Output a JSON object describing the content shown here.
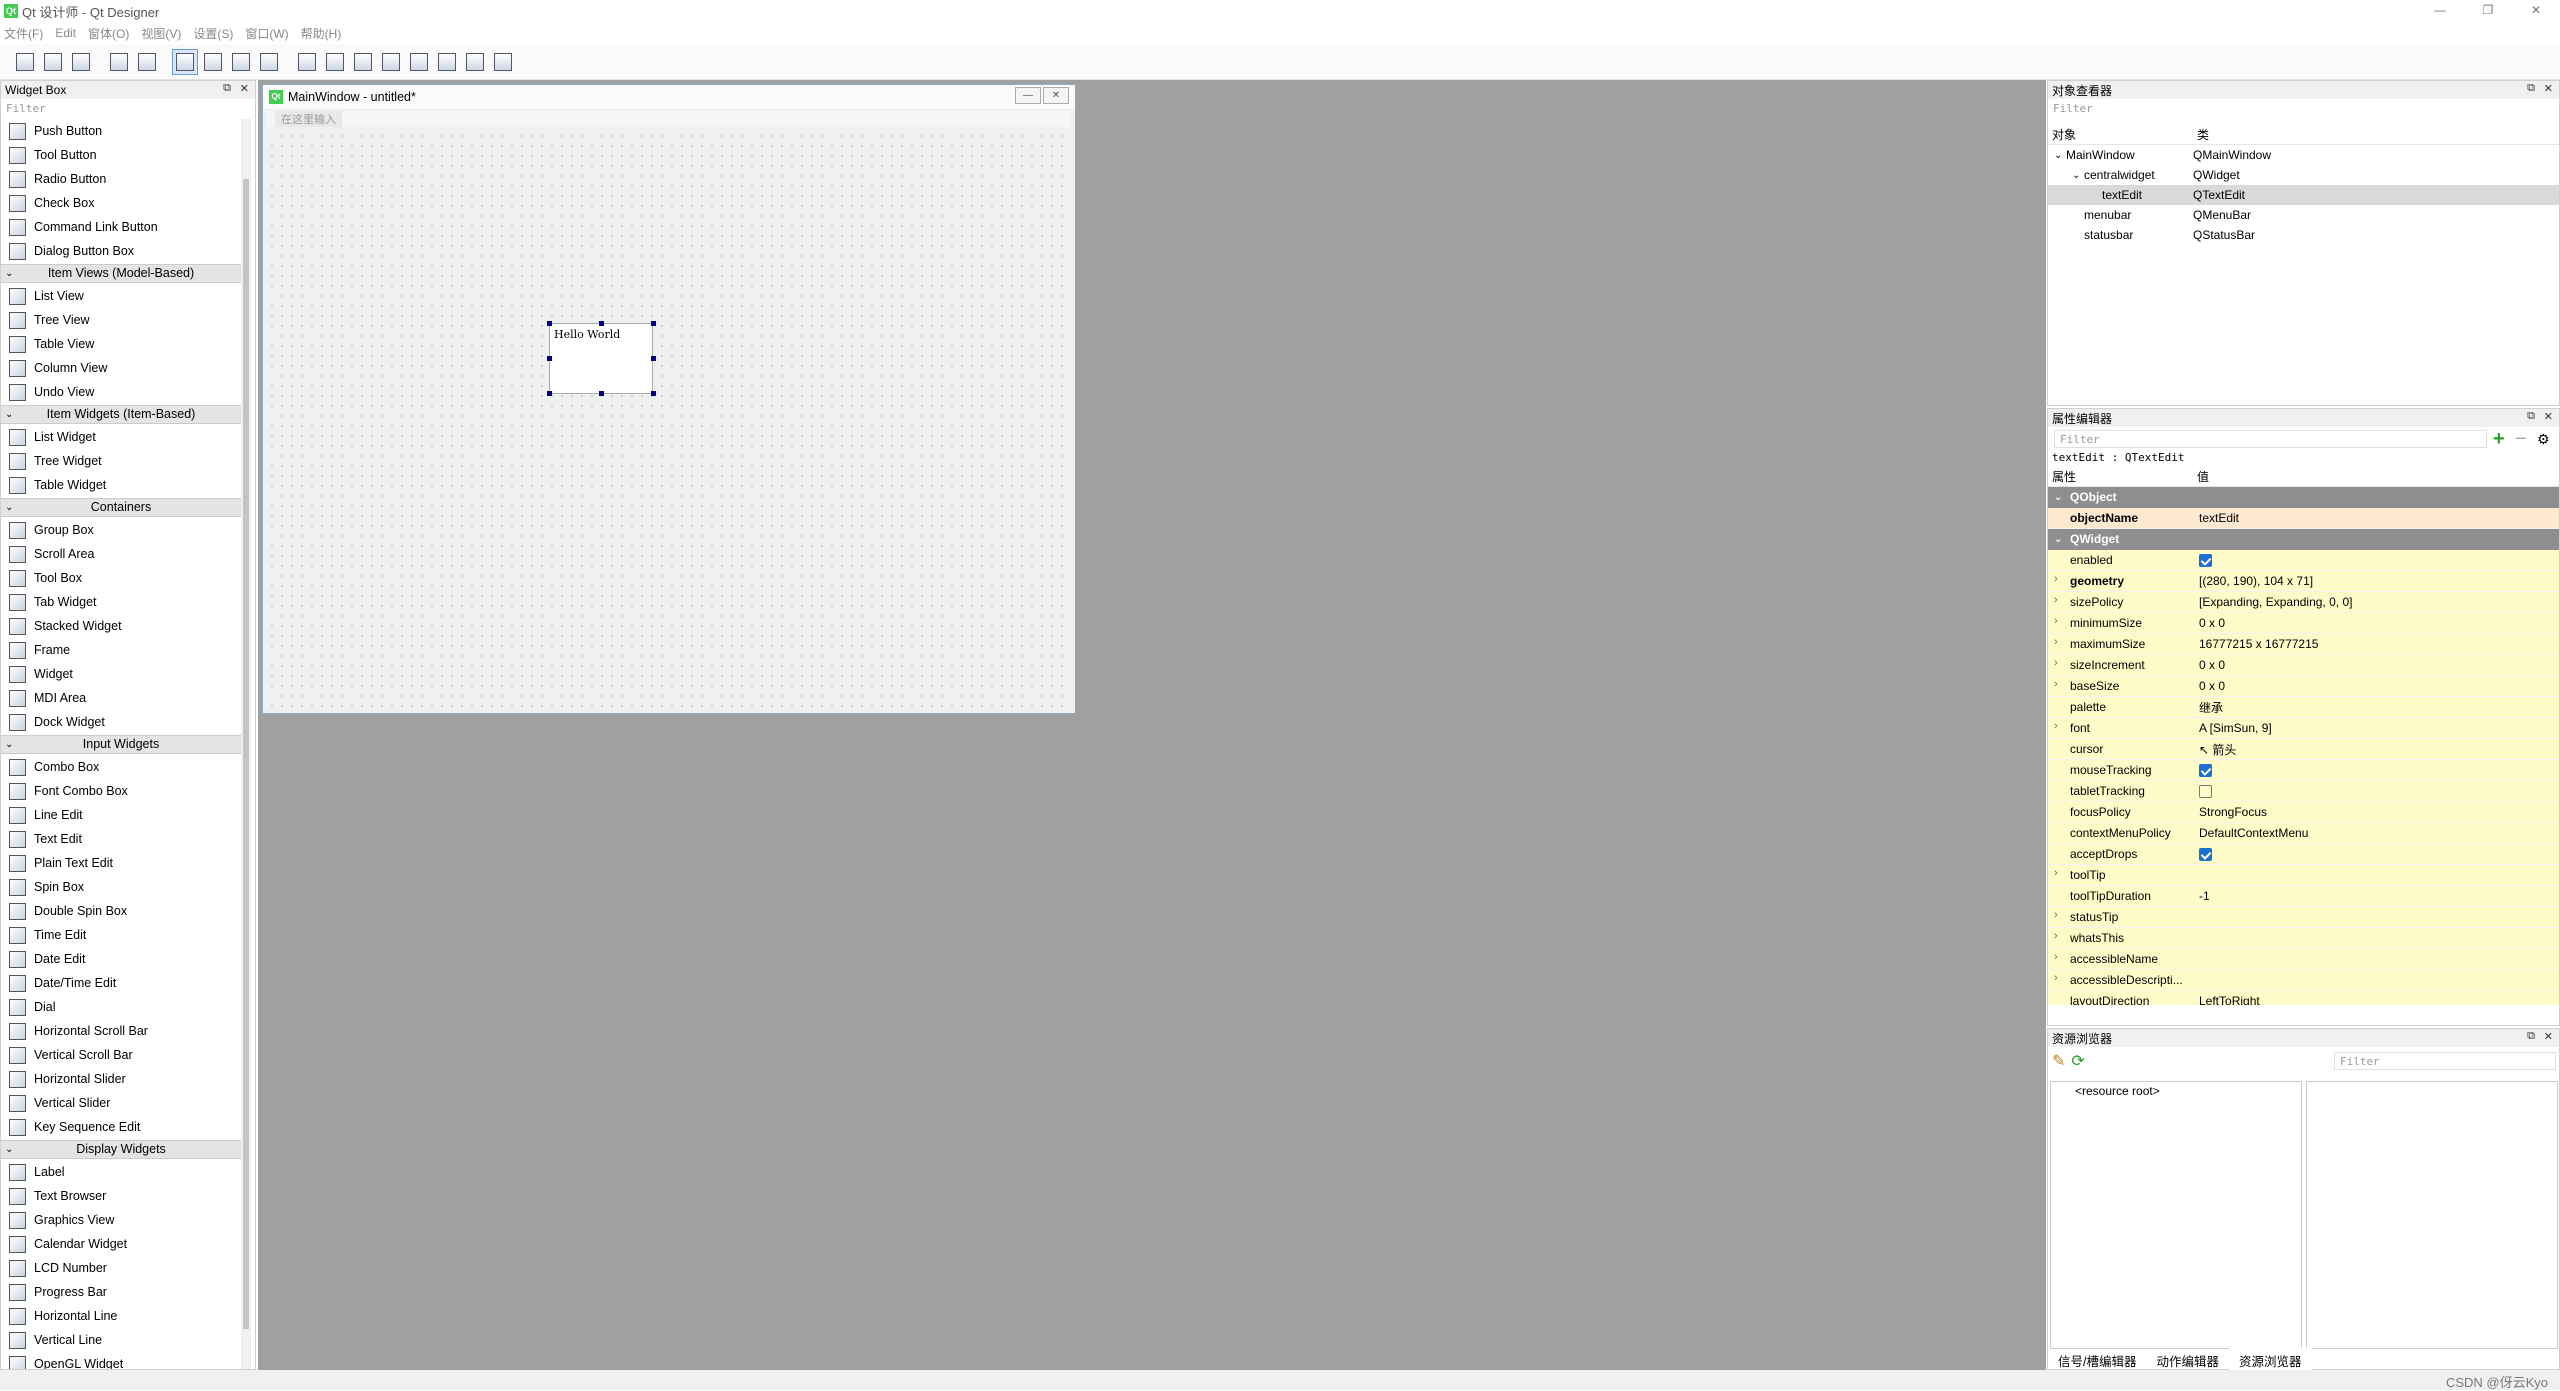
{
  "app": {
    "title": "Qt 设计师 - Qt Designer",
    "icon": "qt-designer-icon"
  },
  "window_controls": [
    "—",
    "❐",
    "✕"
  ],
  "menu": [
    "文件(F)",
    "Edit",
    "窗体(O)",
    "视图(V)",
    "设置(S)",
    "窗口(W)",
    "帮助(H)"
  ],
  "toolbar": [
    "new-icon",
    "open-icon",
    "save-icon",
    "sep",
    "send-to-back-icon",
    "bring-to-front-icon",
    "sep",
    "edit-widgets-icon",
    "edit-signals-icon",
    "edit-buddies-icon",
    "edit-tab-order-icon",
    "sep",
    "layout-horizontal-icon",
    "layout-vertical-icon",
    "layout-h-splitter-icon",
    "layout-v-splitter-icon",
    "layout-grid-icon",
    "layout-form-icon",
    "break-layout-icon",
    "adjust-size-icon"
  ],
  "widget_box": {
    "title": "Widget Box",
    "filter": "Filter",
    "sections": [
      {
        "type": "item",
        "label": "Push Button"
      },
      {
        "type": "item",
        "label": "Tool Button"
      },
      {
        "type": "item",
        "label": "Radio Button"
      },
      {
        "type": "item",
        "label": "Check Box"
      },
      {
        "type": "item",
        "label": "Command Link Button"
      },
      {
        "type": "item",
        "label": "Dialog Button Box"
      },
      {
        "type": "cat",
        "label": "Item Views (Model-Based)"
      },
      {
        "type": "item",
        "label": "List View"
      },
      {
        "type": "item",
        "label": "Tree View"
      },
      {
        "type": "item",
        "label": "Table View"
      },
      {
        "type": "item",
        "label": "Column View"
      },
      {
        "type": "item",
        "label": "Undo View"
      },
      {
        "type": "cat",
        "label": "Item Widgets (Item-Based)"
      },
      {
        "type": "item",
        "label": "List Widget"
      },
      {
        "type": "item",
        "label": "Tree Widget"
      },
      {
        "type": "item",
        "label": "Table Widget"
      },
      {
        "type": "cat",
        "label": "Containers"
      },
      {
        "type": "item",
        "label": "Group Box"
      },
      {
        "type": "item",
        "label": "Scroll Area"
      },
      {
        "type": "item",
        "label": "Tool Box"
      },
      {
        "type": "item",
        "label": "Tab Widget"
      },
      {
        "type": "item",
        "label": "Stacked Widget"
      },
      {
        "type": "item",
        "label": "Frame"
      },
      {
        "type": "item",
        "label": "Widget"
      },
      {
        "type": "item",
        "label": "MDI Area"
      },
      {
        "type": "item",
        "label": "Dock Widget"
      },
      {
        "type": "cat",
        "label": "Input Widgets"
      },
      {
        "type": "item",
        "label": "Combo Box"
      },
      {
        "type": "item",
        "label": "Font Combo Box"
      },
      {
        "type": "item",
        "label": "Line Edit"
      },
      {
        "type": "item",
        "label": "Text Edit"
      },
      {
        "type": "item",
        "label": "Plain Text Edit"
      },
      {
        "type": "item",
        "label": "Spin Box"
      },
      {
        "type": "item",
        "label": "Double Spin Box"
      },
      {
        "type": "item",
        "label": "Time Edit"
      },
      {
        "type": "item",
        "label": "Date Edit"
      },
      {
        "type": "item",
        "label": "Date/Time Edit"
      },
      {
        "type": "item",
        "label": "Dial"
      },
      {
        "type": "item",
        "label": "Horizontal Scroll Bar"
      },
      {
        "type": "item",
        "label": "Vertical Scroll Bar"
      },
      {
        "type": "item",
        "label": "Horizontal Slider"
      },
      {
        "type": "item",
        "label": "Vertical Slider"
      },
      {
        "type": "item",
        "label": "Key Sequence Edit"
      },
      {
        "type": "cat",
        "label": "Display Widgets"
      },
      {
        "type": "item",
        "label": "Label"
      },
      {
        "type": "item",
        "label": "Text Browser"
      },
      {
        "type": "item",
        "label": "Graphics View"
      },
      {
        "type": "item",
        "label": "Calendar Widget"
      },
      {
        "type": "item",
        "label": "LCD Number"
      },
      {
        "type": "item",
        "label": "Progress Bar"
      },
      {
        "type": "item",
        "label": "Horizontal Line"
      },
      {
        "type": "item",
        "label": "Vertical Line"
      },
      {
        "type": "item",
        "label": "OpenGL Widget"
      }
    ]
  },
  "form_window": {
    "title": "MainWindow - untitled*",
    "menu_placeholder": "在这里输入",
    "text_edit_content": "Hello World"
  },
  "object_inspector": {
    "title": "对象查看器",
    "filter": "Filter",
    "col_object": "对象",
    "col_class": "类",
    "rows": [
      {
        "name": "MainWindow",
        "cls": "QMainWindow",
        "level": 0,
        "expand": "⌄"
      },
      {
        "name": "centralwidget",
        "cls": "QWidget",
        "level": 1,
        "expand": "⌄"
      },
      {
        "name": "textEdit",
        "cls": "QTextEdit",
        "level": 2,
        "expand": ""
      },
      {
        "name": "menubar",
        "cls": "QMenuBar",
        "level": 1,
        "expand": ""
      },
      {
        "name": "statusbar",
        "cls": "QStatusBar",
        "level": 1,
        "expand": ""
      }
    ]
  },
  "property_editor": {
    "title": "属性编辑器",
    "filter": "Filter",
    "object_label": "textEdit : QTextEdit",
    "col_property": "属性",
    "col_value": "值",
    "rows": [
      {
        "t": "grp",
        "n": "QObject"
      },
      {
        "t": "p",
        "n": "objectName",
        "v": "textEdit",
        "bold": true,
        "bg": "#fde8d0"
      },
      {
        "t": "grp",
        "n": "QWidget"
      },
      {
        "t": "p",
        "n": "enabled",
        "cb": true,
        "bg": "#fffbc8"
      },
      {
        "t": "p",
        "n": "geometry",
        "v": "[(280, 190), 104 x 71]",
        "bold": true,
        "exp": "›",
        "bg": "#fffbc8"
      },
      {
        "t": "p",
        "n": "sizePolicy",
        "v": "[Expanding, Expanding, 0, 0]",
        "exp": "›",
        "bg": "#fffbc8"
      },
      {
        "t": "p",
        "n": "minimumSize",
        "v": "0 x 0",
        "exp": "›",
        "bg": "#fffbc8"
      },
      {
        "t": "p",
        "n": "maximumSize",
        "v": "16777215 x 16777215",
        "exp": "›",
        "bg": "#fffbc8"
      },
      {
        "t": "p",
        "n": "sizeIncrement",
        "v": "0 x 0",
        "exp": "›",
        "bg": "#fffbc8"
      },
      {
        "t": "p",
        "n": "baseSize",
        "v": "0 x 0",
        "exp": "›",
        "bg": "#fffbc8"
      },
      {
        "t": "p",
        "n": "palette",
        "v": "继承",
        "bg": "#fffbc8"
      },
      {
        "t": "p",
        "n": "font",
        "v": "A  [SimSun, 9]",
        "exp": "›",
        "bg": "#fffbc8"
      },
      {
        "t": "p",
        "n": "cursor",
        "v": "↖  箭头",
        "bg": "#fffbc8"
      },
      {
        "t": "p",
        "n": "mouseTracking",
        "cb": true,
        "bg": "#fffbc8"
      },
      {
        "t": "p",
        "n": "tabletTracking",
        "cb": false,
        "bg": "#fffbc8"
      },
      {
        "t": "p",
        "n": "focusPolicy",
        "v": "StrongFocus",
        "bg": "#fffbc8"
      },
      {
        "t": "p",
        "n": "contextMenuPolicy",
        "v": "DefaultContextMenu",
        "bg": "#fffbc8"
      },
      {
        "t": "p",
        "n": "acceptDrops",
        "cb": true,
        "bg": "#fffbc8"
      },
      {
        "t": "p",
        "n": "toolTip",
        "v": "",
        "exp": "›",
        "bg": "#fffbc8"
      },
      {
        "t": "p",
        "n": "toolTipDuration",
        "v": "-1",
        "bg": "#fffbc8"
      },
      {
        "t": "p",
        "n": "statusTip",
        "v": "",
        "exp": "›",
        "bg": "#fffbc8"
      },
      {
        "t": "p",
        "n": "whatsThis",
        "v": "",
        "exp": "›",
        "bg": "#fffbc8"
      },
      {
        "t": "p",
        "n": "accessibleName",
        "v": "",
        "exp": "›",
        "bg": "#fffbc8"
      },
      {
        "t": "p",
        "n": "accessibleDescripti...",
        "v": "",
        "exp": "›",
        "bg": "#fffbc8"
      },
      {
        "t": "p",
        "n": "layoutDirection",
        "v": "LeftToRight",
        "bg": "#fffbc8"
      }
    ]
  },
  "resource_browser": {
    "title": "资源浏览器",
    "filter": "Filter",
    "root": "<resource root>"
  },
  "bottom_tabs": [
    "信号/槽编辑器",
    "动作编辑器",
    "资源浏览器"
  ],
  "watermark": "CSDN @伢云Kyo",
  "colors": {
    "workspace": "#a0a0a0",
    "property_bg": "#fffbc8",
    "group_header": "#8e8e8e",
    "qt_green": "#41cd52"
  }
}
